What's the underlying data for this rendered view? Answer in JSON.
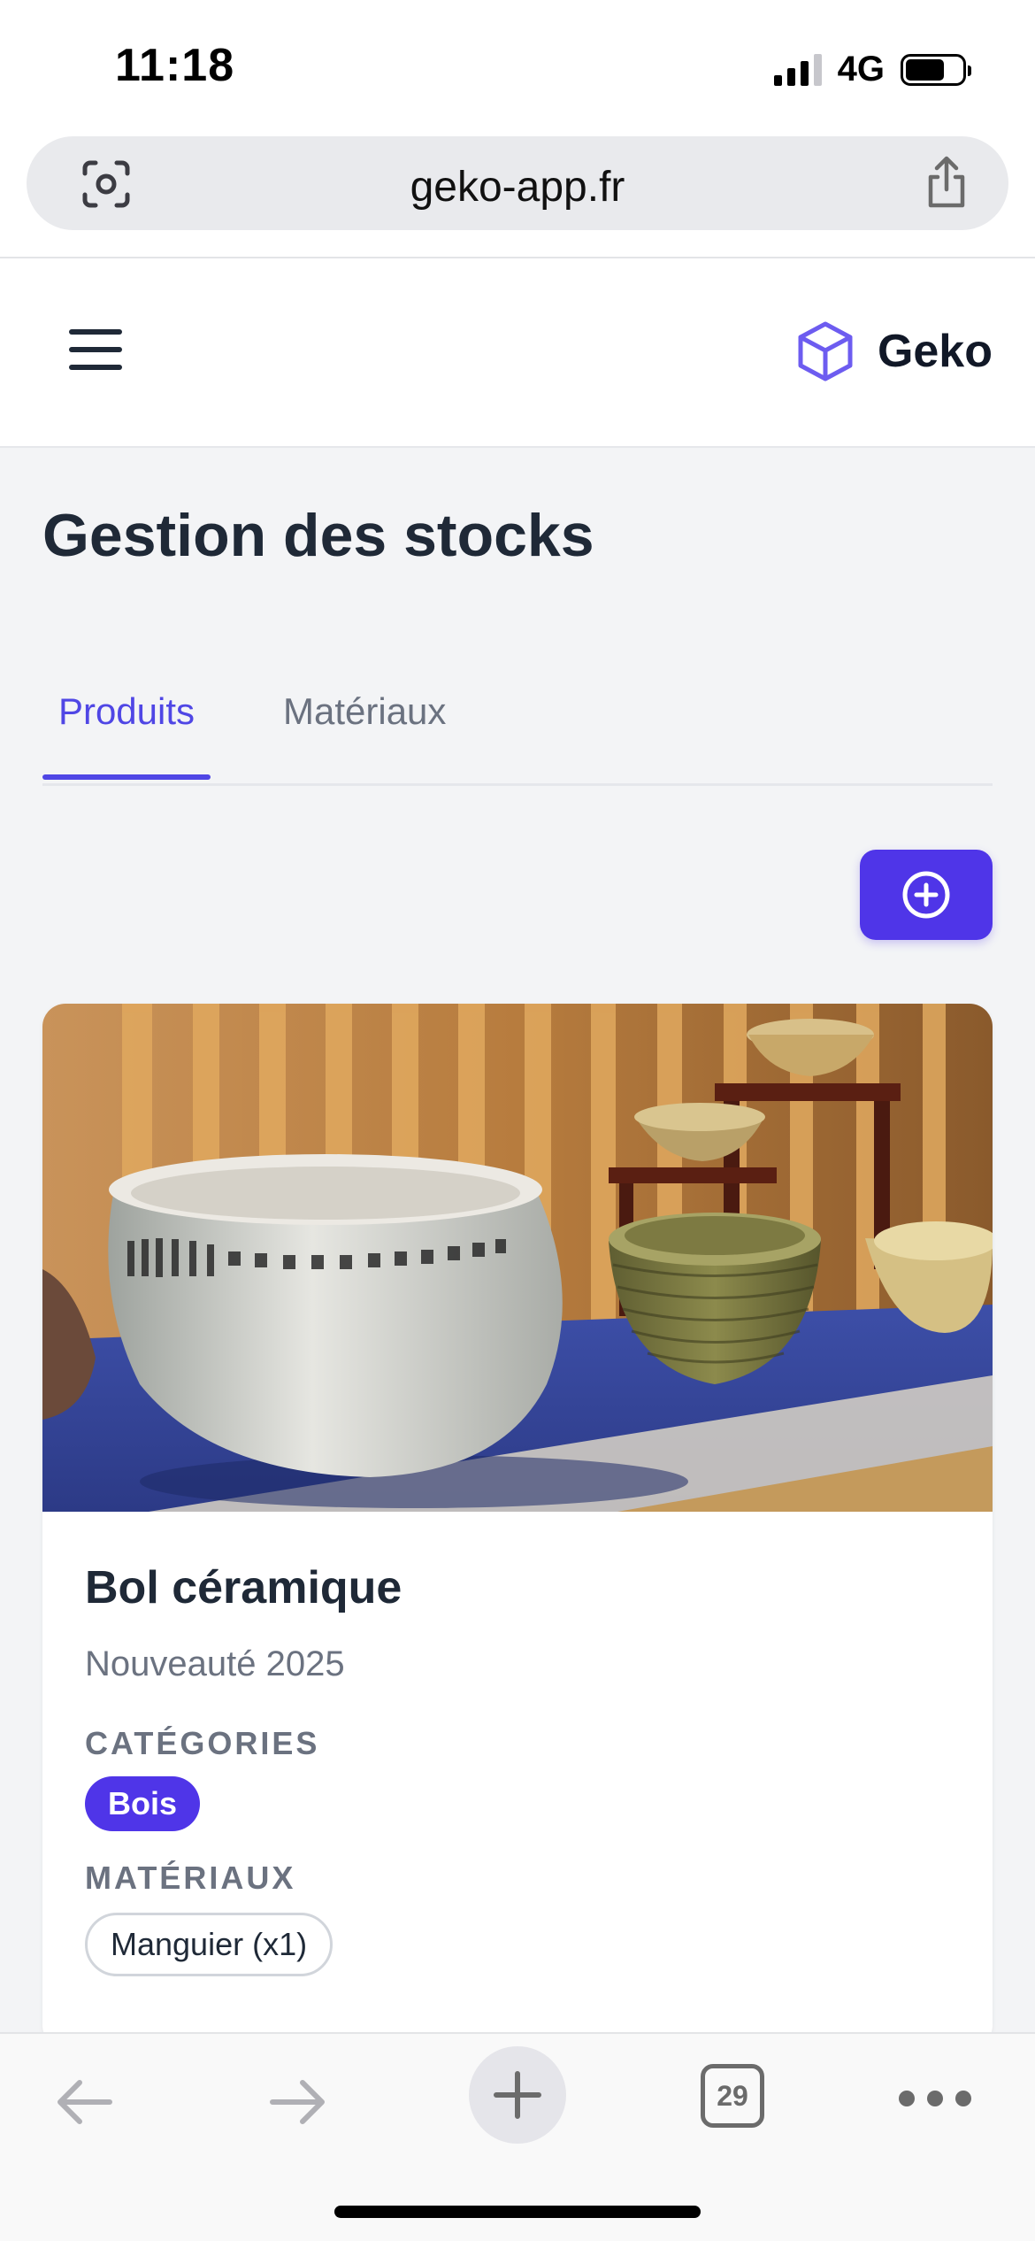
{
  "status_bar": {
    "time": "11:18",
    "network": "4G"
  },
  "browser": {
    "url": "geko-app.fr",
    "open_tab_count": "29"
  },
  "header": {
    "brand_name": "Geko",
    "brand_color": "#6d5cf0"
  },
  "page": {
    "title": "Gestion des stocks",
    "tabs": [
      {
        "label": "Produits",
        "active": true
      },
      {
        "label": "Matériaux",
        "active": false
      }
    ],
    "accent_color": "#4f35e8"
  },
  "product": {
    "name": "Bol céramique",
    "subtitle": "Nouveauté 2025",
    "categories_label": "CATÉGORIES",
    "categories": [
      "Bois"
    ],
    "materials_label": "MATÉRIAUX",
    "materials": [
      "Manguier (x1)"
    ]
  },
  "icons": {
    "menu": "hamburger-menu-icon",
    "brand": "cube-icon",
    "add": "plus-circle-icon",
    "lens": "visual-lookup-icon",
    "share": "share-icon",
    "back": "arrow-left-icon",
    "forward": "arrow-right-icon",
    "new_tab": "plus-icon",
    "more": "ellipsis-icon"
  }
}
